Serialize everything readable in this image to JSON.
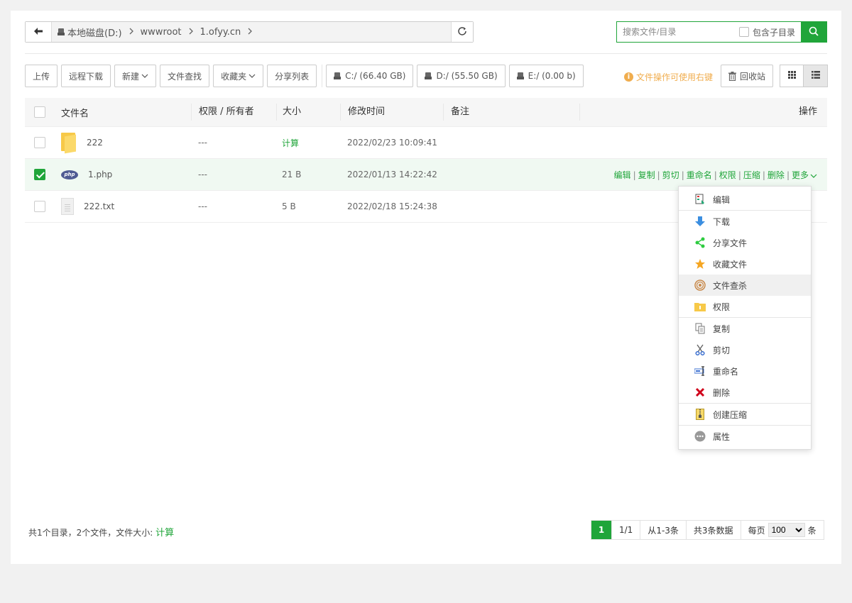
{
  "path": {
    "crumbs": [
      "本地磁盘(D:)",
      "wwwroot",
      "1.ofyy.cn"
    ]
  },
  "search": {
    "placeholder": "搜索文件/目录",
    "subdir_label": "包含子目录"
  },
  "toolbar": {
    "upload": "上传",
    "remote_download": "远程下载",
    "new": "新建",
    "file_search": "文件查找",
    "favorites": "收藏夹",
    "share_list": "分享列表",
    "disks": [
      "C:/ (66.40 GB)",
      "D:/ (55.50 GB)",
      "E:/ (0.00 b)"
    ],
    "tip": "文件操作可使用右键",
    "recycle": "回收站"
  },
  "table": {
    "headers": {
      "name": "文件名",
      "perm": "权限 / 所有者",
      "size": "大小",
      "mtime": "修改时间",
      "note": "备注",
      "ops": "操作"
    },
    "rows": [
      {
        "name": "222",
        "type": "folder",
        "perm": "---",
        "size": "计算",
        "mtime": "2022/02/23 10:09:41",
        "checked": false
      },
      {
        "name": "1.php",
        "type": "php",
        "perm": "---",
        "size": "21 B",
        "mtime": "2022/01/13 14:22:42",
        "checked": true
      },
      {
        "name": "222.txt",
        "type": "txt",
        "perm": "---",
        "size": "5 B",
        "mtime": "2022/02/18 15:24:38",
        "checked": false
      }
    ],
    "row_ops": [
      "编辑",
      "复制",
      "剪切",
      "重命名",
      "权限",
      "压缩",
      "删除",
      "更多"
    ],
    "php_icon_text": "php"
  },
  "menu": {
    "items": [
      "编辑",
      "下载",
      "分享文件",
      "收藏文件",
      "文件查杀",
      "权限",
      "复制",
      "剪切",
      "重命名",
      "删除",
      "创建压缩",
      "属性"
    ]
  },
  "footer": {
    "summary": "共1个目录，2个文件，文件大小:",
    "summary_link": "计算",
    "current_page": "1",
    "page_of": "1/1",
    "range": "从1-3条",
    "total": "共3条数据",
    "per_page_label": "每页",
    "per_page_value": "100",
    "per_page_unit": "条"
  },
  "colors": {
    "accent": "#20a53a",
    "warning": "#f0ad4e"
  }
}
